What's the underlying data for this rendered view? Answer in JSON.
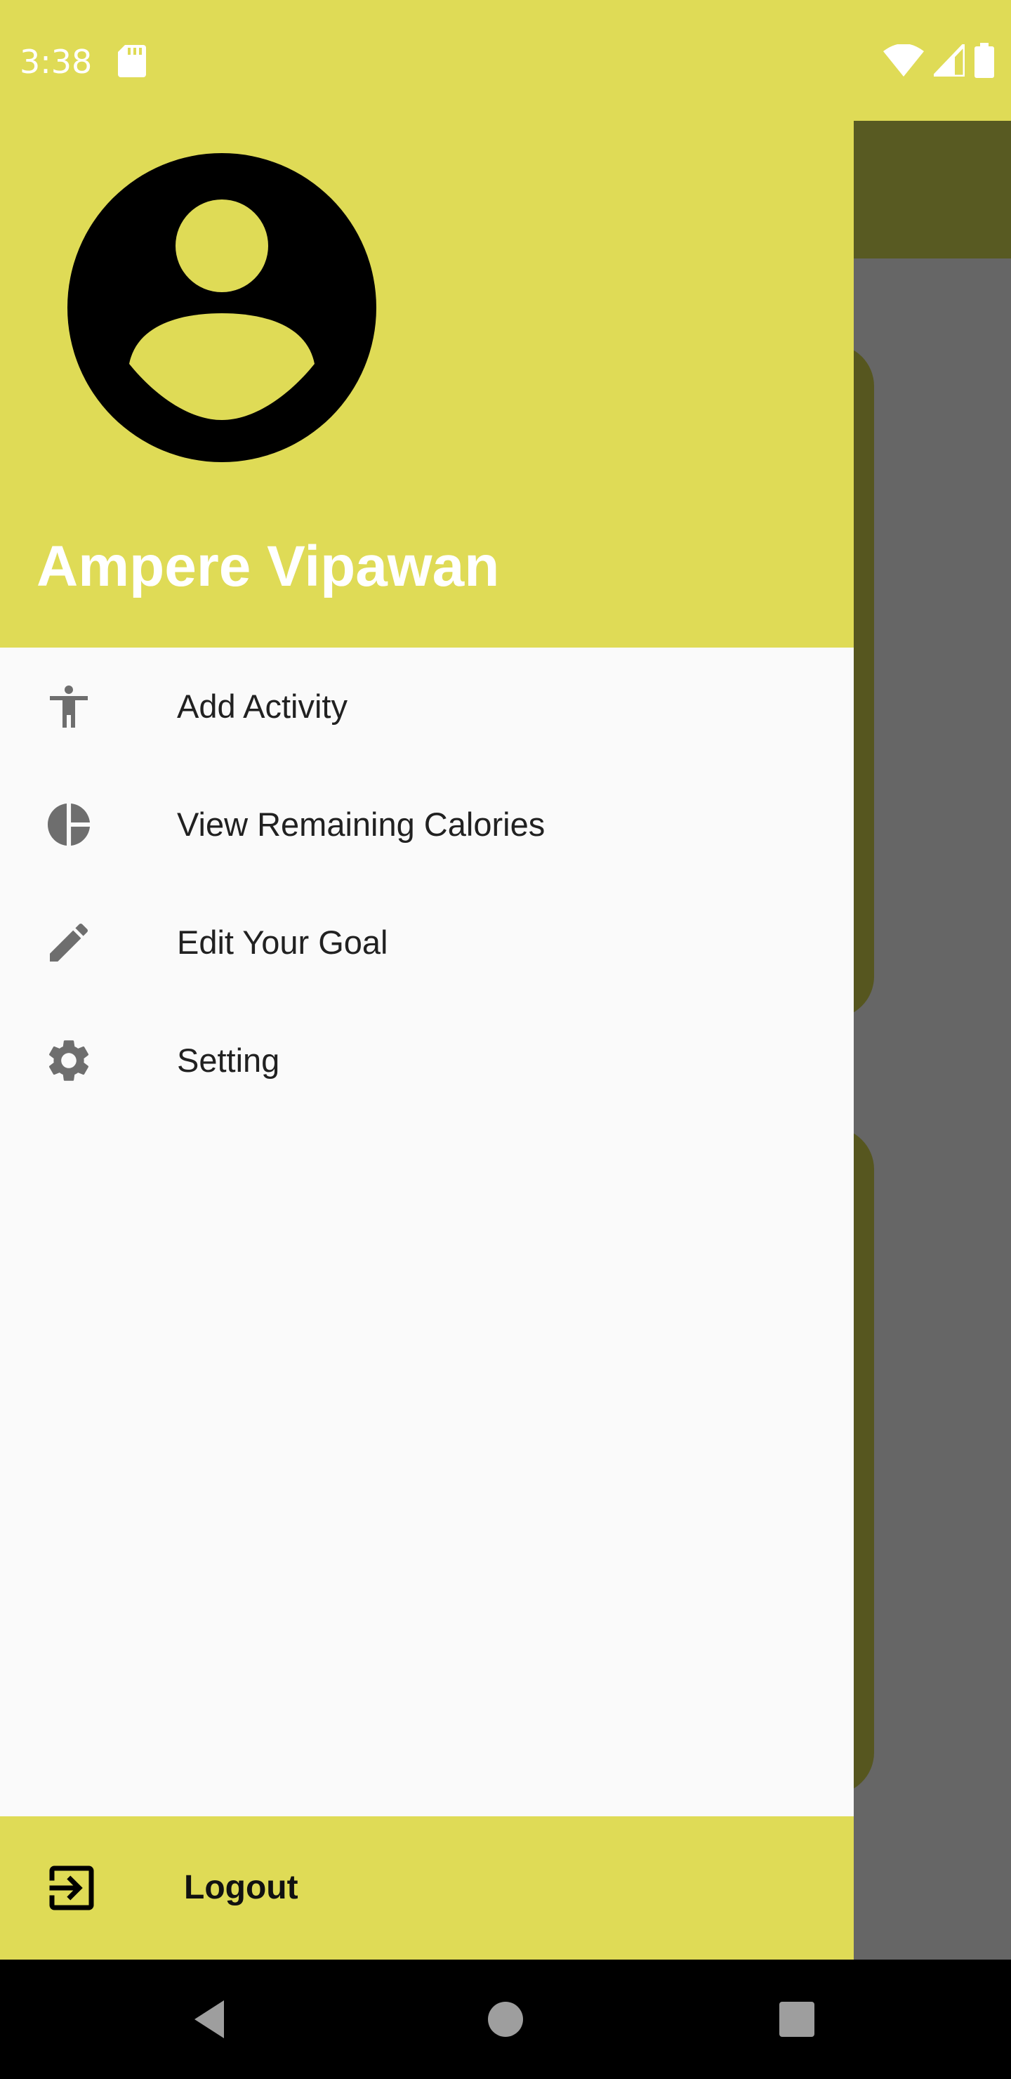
{
  "status_bar": {
    "time": "3:38",
    "icons": [
      "sd-card-icon",
      "wifi-icon",
      "cell-signal-icon",
      "battery-icon"
    ]
  },
  "drawer": {
    "user_name": "Ampere Vipawan",
    "avatar_icon": "account-circle-icon",
    "menu": [
      {
        "label": "Add Activity",
        "icon": "accessibility-icon"
      },
      {
        "label": "View Remaining Calories",
        "icon": "pie-chart-icon"
      },
      {
        "label": "Edit Your Goal",
        "icon": "pencil-icon"
      },
      {
        "label": "Setting",
        "icon": "gear-icon"
      }
    ],
    "logout": {
      "label": "Logout",
      "icon": "exit-icon"
    }
  },
  "nav_bar": {
    "buttons": [
      "back-icon",
      "home-icon",
      "recents-icon"
    ]
  },
  "colors": {
    "accent": "#dfdb56",
    "drawer_bg": "#fafafa",
    "scrim": "#666666",
    "icon_gray": "#6e6e6e",
    "text": "#212121"
  }
}
